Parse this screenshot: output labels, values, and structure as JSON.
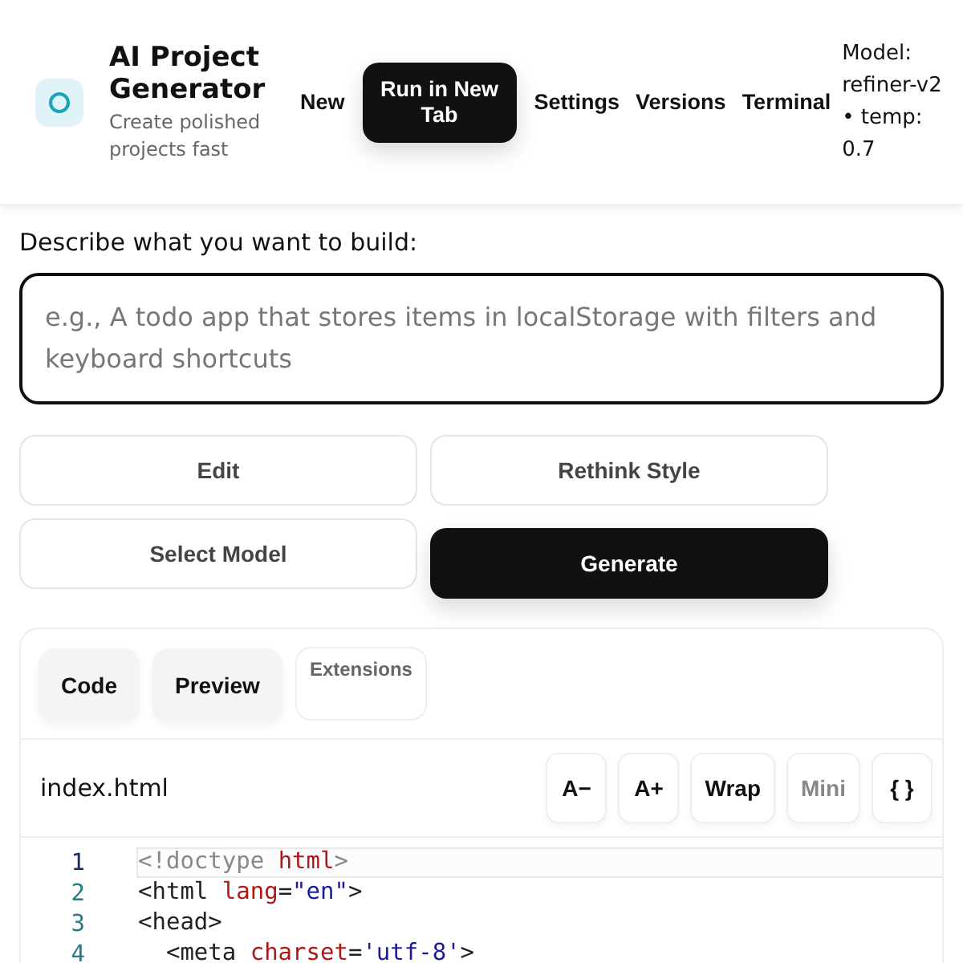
{
  "header": {
    "title": "AI Project Generator",
    "subtitle": "Create polished projects fast",
    "nav": [
      {
        "label": "New",
        "kind": "link"
      },
      {
        "label": "Run in New Tab",
        "kind": "primary"
      },
      {
        "label": "Settings",
        "kind": "link"
      },
      {
        "label": "Versions",
        "kind": "link"
      },
      {
        "label": "Terminal",
        "kind": "link"
      }
    ],
    "model_info": "Model: refiner-v2 • temp: 0.7"
  },
  "prompt": {
    "label": "Describe what you want to build:",
    "placeholder": "e.g., A todo app that stores items in localStorage with filters and keyboard shortcuts"
  },
  "actions": [
    {
      "label": "Edit",
      "kind": "secondary"
    },
    {
      "label": "Rethink Style",
      "kind": "secondary"
    },
    {
      "label": "Select Model",
      "kind": "secondary"
    },
    {
      "label": "Generate",
      "kind": "primary"
    }
  ],
  "editor": {
    "tabs": [
      {
        "label": "Code",
        "disabled": false
      },
      {
        "label": "Preview",
        "disabled": false
      },
      {
        "label": "Extensions",
        "disabled": true
      }
    ],
    "filename": "index.html",
    "tools": [
      {
        "label": "A−",
        "disabled": false
      },
      {
        "label": "A+",
        "disabled": false
      },
      {
        "label": "Wrap",
        "disabled": false
      },
      {
        "label": "Mini",
        "disabled": true
      },
      {
        "label": "{ }",
        "disabled": false
      }
    ],
    "lines": [
      {
        "number": "1",
        "active": true,
        "tokens": [
          {
            "text": "<!doctype ",
            "kind": "meta"
          },
          {
            "text": "html",
            "kind": "attr"
          },
          {
            "text": ">",
            "kind": "meta"
          }
        ]
      },
      {
        "number": "2",
        "active": false,
        "tokens": [
          {
            "text": "<html ",
            "kind": "tag"
          },
          {
            "text": "lang",
            "kind": "attr"
          },
          {
            "text": "=",
            "kind": "tag"
          },
          {
            "text": "\"en\"",
            "kind": "string"
          },
          {
            "text": ">",
            "kind": "tag"
          }
        ]
      },
      {
        "number": "3",
        "active": false,
        "tokens": [
          {
            "text": "<head>",
            "kind": "tag"
          }
        ]
      },
      {
        "number": "4",
        "active": false,
        "tokens": [
          {
            "text": "  <meta ",
            "kind": "tag"
          },
          {
            "text": "charset",
            "kind": "attr"
          },
          {
            "text": "=",
            "kind": "tag"
          },
          {
            "text": "'utf-8'",
            "kind": "string"
          },
          {
            "text": ">",
            "kind": "tag"
          }
        ]
      }
    ]
  }
}
